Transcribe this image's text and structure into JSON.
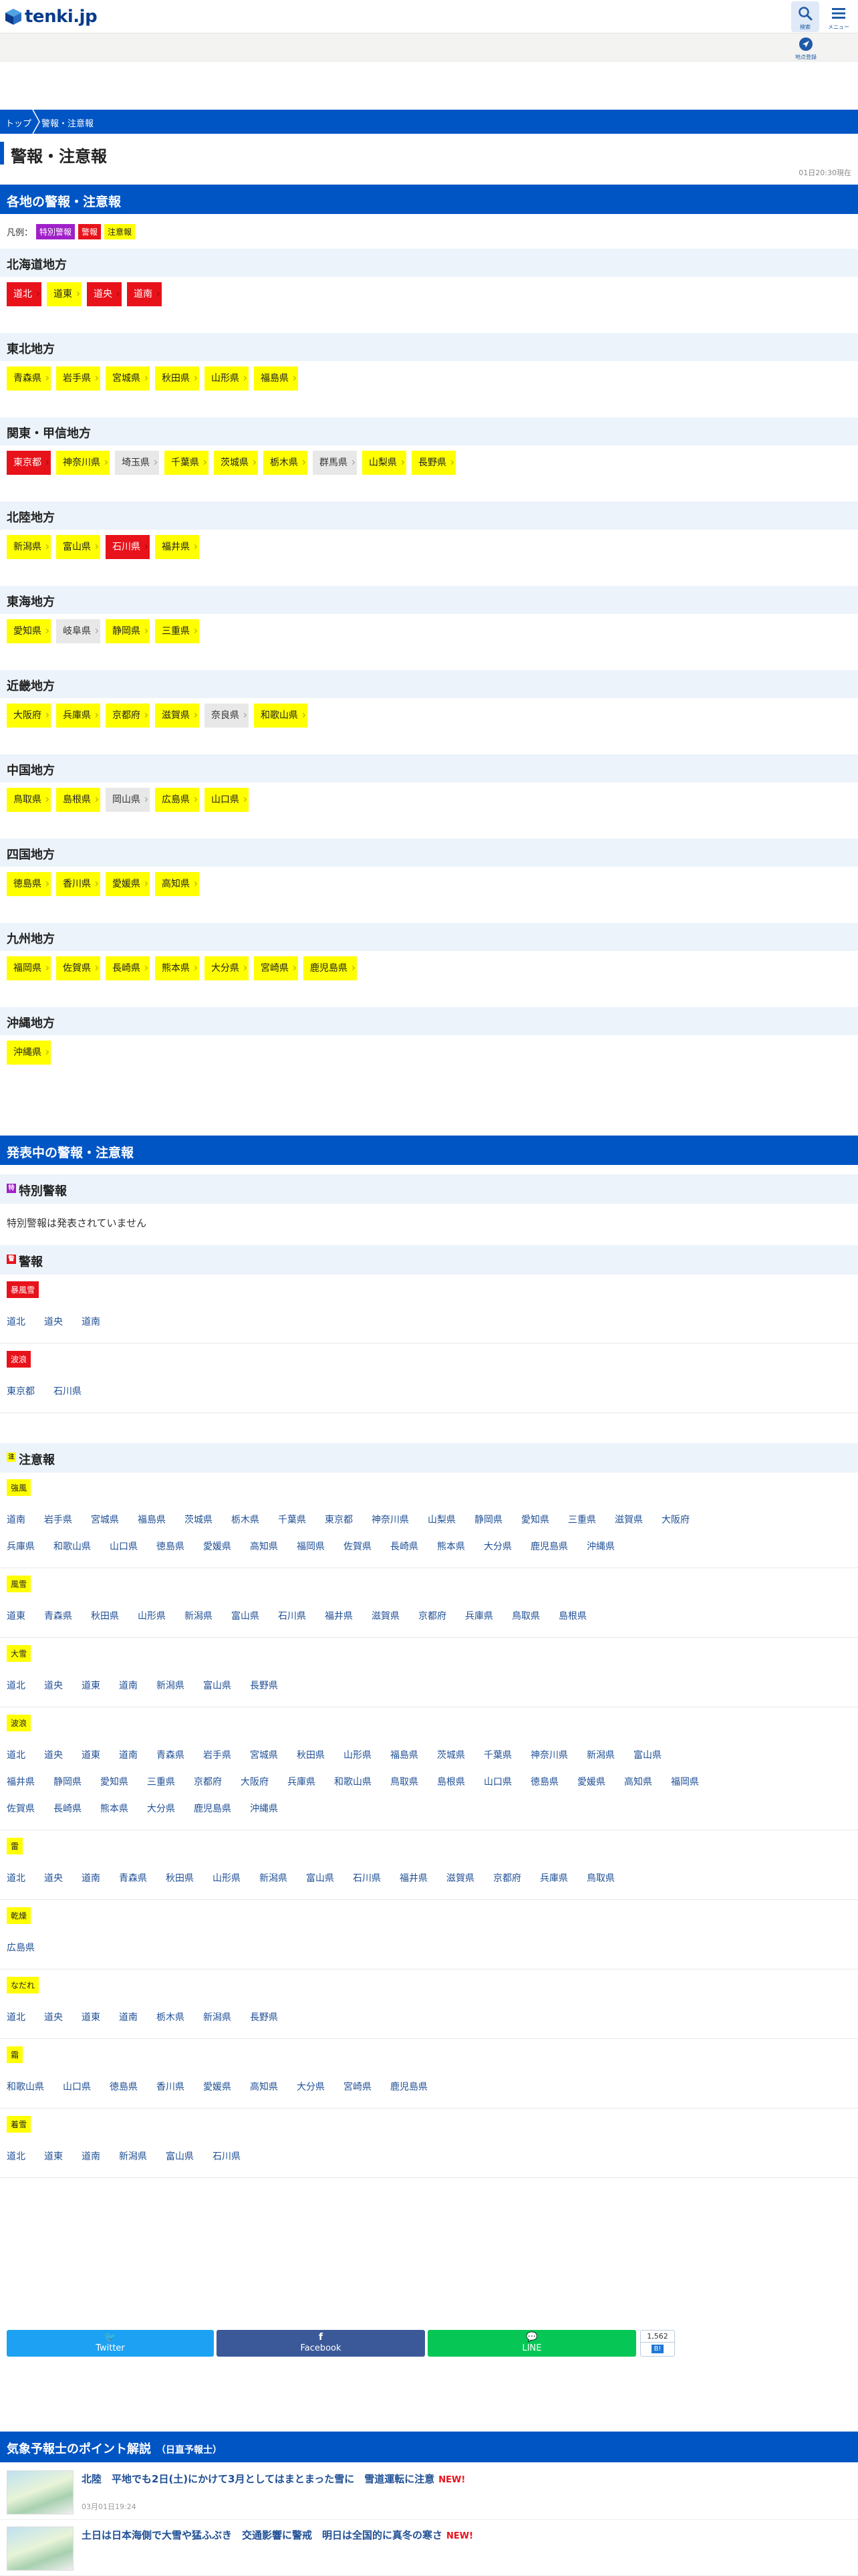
{
  "header": {
    "logo_text": "tenki.jp",
    "search_label": "検索",
    "menu_label": "メニュー",
    "mypoint_label": "地点登録"
  },
  "breadcrumb": {
    "top": "トップ",
    "current": "警報・注意報"
  },
  "page_title": "警報・注意報",
  "timestamp": "01日20:30現在",
  "regional": {
    "heading": "各地の警報・注意報",
    "legend_label": "凡例：",
    "legend": [
      "特別警報",
      "警報",
      "注意報"
    ],
    "regions": [
      {
        "name": "北海道地方",
        "prefs": [
          {
            "name": "道北",
            "level": "warning"
          },
          {
            "name": "道東",
            "level": "advisory"
          },
          {
            "name": "道央",
            "level": "warning"
          },
          {
            "name": "道南",
            "level": "warning"
          }
        ]
      },
      {
        "name": "東北地方",
        "prefs": [
          {
            "name": "青森県",
            "level": "advisory"
          },
          {
            "name": "岩手県",
            "level": "advisory"
          },
          {
            "name": "宮城県",
            "level": "advisory"
          },
          {
            "name": "秋田県",
            "level": "advisory"
          },
          {
            "name": "山形県",
            "level": "advisory"
          },
          {
            "name": "福島県",
            "level": "advisory"
          }
        ]
      },
      {
        "name": "関東・甲信地方",
        "prefs": [
          {
            "name": "東京都",
            "level": "warning"
          },
          {
            "name": "神奈川県",
            "level": "advisory"
          },
          {
            "name": "埼玉県",
            "level": "none"
          },
          {
            "name": "千葉県",
            "level": "advisory"
          },
          {
            "name": "茨城県",
            "level": "advisory"
          },
          {
            "name": "栃木県",
            "level": "advisory"
          },
          {
            "name": "群馬県",
            "level": "none"
          },
          {
            "name": "山梨県",
            "level": "advisory"
          },
          {
            "name": "長野県",
            "level": "advisory"
          }
        ]
      },
      {
        "name": "北陸地方",
        "prefs": [
          {
            "name": "新潟県",
            "level": "advisory"
          },
          {
            "name": "富山県",
            "level": "advisory"
          },
          {
            "name": "石川県",
            "level": "warning"
          },
          {
            "name": "福井県",
            "level": "advisory"
          }
        ]
      },
      {
        "name": "東海地方",
        "prefs": [
          {
            "name": "愛知県",
            "level": "advisory"
          },
          {
            "name": "岐阜県",
            "level": "none"
          },
          {
            "name": "静岡県",
            "level": "advisory"
          },
          {
            "name": "三重県",
            "level": "advisory"
          }
        ]
      },
      {
        "name": "近畿地方",
        "prefs": [
          {
            "name": "大阪府",
            "level": "advisory"
          },
          {
            "name": "兵庫県",
            "level": "advisory"
          },
          {
            "name": "京都府",
            "level": "advisory"
          },
          {
            "name": "滋賀県",
            "level": "advisory"
          },
          {
            "name": "奈良県",
            "level": "none"
          },
          {
            "name": "和歌山県",
            "level": "advisory"
          }
        ]
      },
      {
        "name": "中国地方",
        "prefs": [
          {
            "name": "鳥取県",
            "level": "advisory"
          },
          {
            "name": "島根県",
            "level": "advisory"
          },
          {
            "name": "岡山県",
            "level": "none"
          },
          {
            "name": "広島県",
            "level": "advisory"
          },
          {
            "name": "山口県",
            "level": "advisory"
          }
        ]
      },
      {
        "name": "四国地方",
        "prefs": [
          {
            "name": "徳島県",
            "level": "advisory"
          },
          {
            "name": "香川県",
            "level": "advisory"
          },
          {
            "name": "愛媛県",
            "level": "advisory"
          },
          {
            "name": "高知県",
            "level": "advisory"
          }
        ]
      },
      {
        "name": "九州地方",
        "prefs": [
          {
            "name": "福岡県",
            "level": "advisory"
          },
          {
            "name": "佐賀県",
            "level": "advisory"
          },
          {
            "name": "長崎県",
            "level": "advisory"
          },
          {
            "name": "熊本県",
            "level": "advisory"
          },
          {
            "name": "大分県",
            "level": "advisory"
          },
          {
            "name": "宮崎県",
            "level": "advisory"
          },
          {
            "name": "鹿児島県",
            "level": "advisory"
          }
        ]
      },
      {
        "name": "沖縄地方",
        "prefs": [
          {
            "name": "沖縄県",
            "level": "advisory"
          }
        ]
      }
    ]
  },
  "active": {
    "heading": "発表中の警報・注意報",
    "special": {
      "title": "特別警報",
      "icon": "特",
      "note": "特別警報は発表されていません"
    },
    "warnings": {
      "title": "警報",
      "icon": "警",
      "types": [
        {
          "label": "暴風雪",
          "rows": [
            [
              "道北",
              "道央",
              "道南"
            ]
          ]
        },
        {
          "label": "波浪",
          "rows": [
            [
              "東京都",
              "石川県"
            ]
          ]
        }
      ]
    },
    "advisories": {
      "title": "注意報",
      "icon": "注",
      "types": [
        {
          "label": "強風",
          "rows": [
            [
              "道南",
              "岩手県",
              "宮城県",
              "福島県",
              "茨城県",
              "栃木県",
              "千葉県",
              "東京都",
              "神奈川県",
              "山梨県",
              "静岡県",
              "愛知県",
              "三重県",
              "滋賀県",
              "大阪府"
            ],
            [
              "兵庫県",
              "和歌山県",
              "山口県",
              "徳島県",
              "愛媛県",
              "高知県",
              "福岡県",
              "佐賀県",
              "長崎県",
              "熊本県",
              "大分県",
              "鹿児島県",
              "沖縄県"
            ]
          ]
        },
        {
          "label": "風雪",
          "rows": [
            [
              "道東",
              "青森県",
              "秋田県",
              "山形県",
              "新潟県",
              "富山県",
              "石川県",
              "福井県",
              "滋賀県",
              "京都府",
              "兵庫県",
              "鳥取県",
              "島根県"
            ]
          ]
        },
        {
          "label": "大雪",
          "rows": [
            [
              "道北",
              "道央",
              "道東",
              "道南",
              "新潟県",
              "富山県",
              "長野県"
            ]
          ]
        },
        {
          "label": "波浪",
          "rows": [
            [
              "道北",
              "道央",
              "道東",
              "道南",
              "青森県",
              "岩手県",
              "宮城県",
              "秋田県",
              "山形県",
              "福島県",
              "茨城県",
              "千葉県",
              "神奈川県",
              "新潟県",
              "富山県"
            ],
            [
              "福井県",
              "静岡県",
              "愛知県",
              "三重県",
              "京都府",
              "大阪府",
              "兵庫県",
              "和歌山県",
              "鳥取県",
              "島根県",
              "山口県",
              "徳島県",
              "愛媛県",
              "高知県",
              "福岡県"
            ],
            [
              "佐賀県",
              "長崎県",
              "熊本県",
              "大分県",
              "鹿児島県",
              "沖縄県"
            ]
          ]
        },
        {
          "label": "雷",
          "rows": [
            [
              "道北",
              "道央",
              "道南",
              "青森県",
              "秋田県",
              "山形県",
              "新潟県",
              "富山県",
              "石川県",
              "福井県",
              "滋賀県",
              "京都府",
              "兵庫県",
              "鳥取県"
            ]
          ]
        },
        {
          "label": "乾燥",
          "rows": [
            [
              "広島県"
            ]
          ]
        },
        {
          "label": "なだれ",
          "rows": [
            [
              "道北",
              "道央",
              "道東",
              "道南",
              "栃木県",
              "新潟県",
              "長野県"
            ]
          ]
        },
        {
          "label": "霜",
          "rows": [
            [
              "和歌山県",
              "山口県",
              "徳島県",
              "香川県",
              "愛媛県",
              "高知県",
              "大分県",
              "宮崎県",
              "鹿児島県"
            ]
          ]
        },
        {
          "label": "着雪",
          "rows": [
            [
              "道北",
              "道東",
              "道南",
              "新潟県",
              "富山県",
              "石川県"
            ]
          ]
        }
      ]
    }
  },
  "share": {
    "twitter": "Twitter",
    "facebook": "Facebook",
    "line": "LINE",
    "hatena_count": "1,562",
    "hatena_label": "B!"
  },
  "forecaster": {
    "heading": "気象予報士のポイント解説",
    "sub": "（日直予報士）",
    "articles": [
      {
        "title": "北陸　平地でも2日(土)にかけて3月としてはまとまった雪に　雪道運転に注意",
        "new": "NEW!",
        "date": "03月01日19:24"
      },
      {
        "title": "土日は日本海側で大雪や猛ふぶき　交通影響に警戒　明日は全国的に真冬の寒さ",
        "new": "NEW!",
        "date": ""
      }
    ]
  },
  "colors": {
    "brand": "#0055c4",
    "special": "#a020c8",
    "warning": "#e8121b",
    "advisory": "#ffff00",
    "none": "#e8e8e8",
    "twitter": "#1da1f2",
    "facebook": "#3b5998",
    "line": "#06c755"
  }
}
